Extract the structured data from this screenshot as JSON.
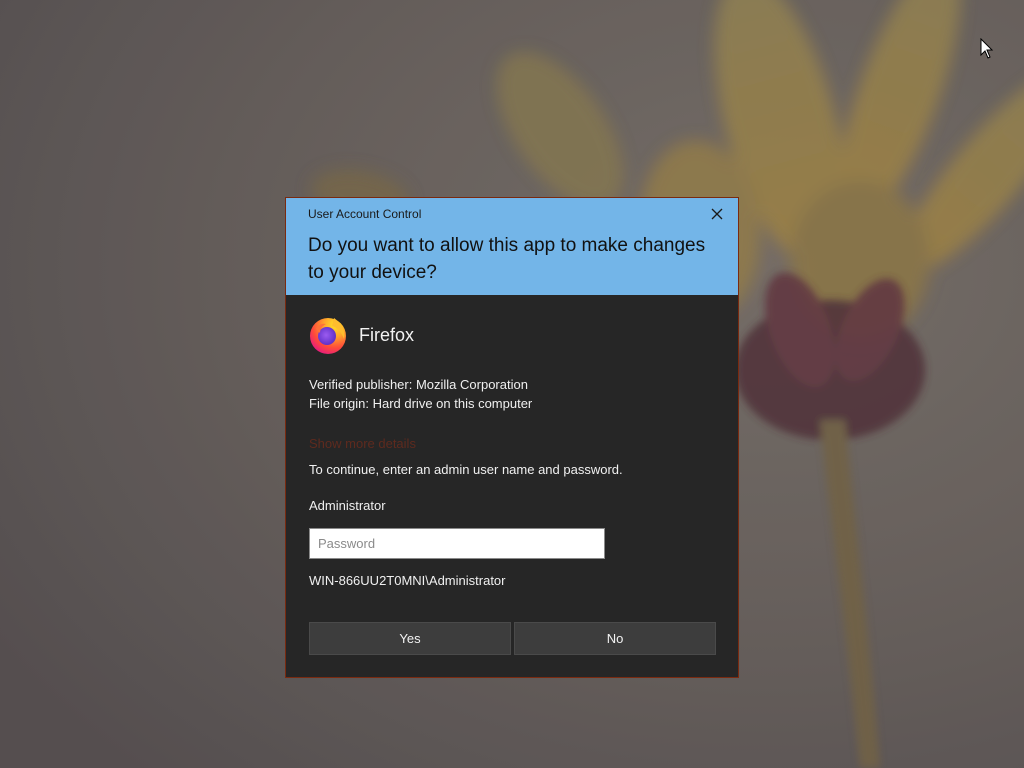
{
  "dialog": {
    "title": "User Account Control",
    "question": "Do you want to allow this app to make changes to your device?",
    "app_name": "Firefox",
    "publisher": "Verified publisher: Mozilla Corporation",
    "origin": "File origin: Hard drive on this computer",
    "show_more": "Show more details",
    "instruction": "To continue, enter an admin user name and password.",
    "username": "Administrator",
    "password_placeholder": "Password",
    "password_value": "",
    "account": "WIN-866UU2T0MNI\\Administrator",
    "yes_label": "Yes",
    "no_label": "No",
    "icons": {
      "app": "firefox-icon",
      "close": "close-icon"
    },
    "colors": {
      "header_bg": "#73b5e8",
      "body_bg": "#262626",
      "button_bg": "#3d3d3d"
    }
  }
}
